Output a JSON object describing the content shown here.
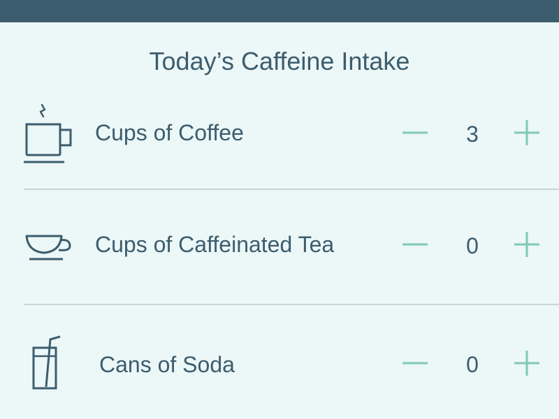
{
  "title": "Today’s Caffeine Intake",
  "colors": {
    "header": "#3c5d6e",
    "background": "#ecf7f7",
    "accent": "#7fcab0",
    "text": "#3c5d6e",
    "divider": "#c6d6d8"
  },
  "items": [
    {
      "icon": "coffee-mug-icon",
      "label": "Cups of Coffee",
      "count": "3"
    },
    {
      "icon": "teacup-icon",
      "label": "Cups of Caffeinated Tea",
      "count": "0"
    },
    {
      "icon": "soda-glass-icon",
      "label": "Cans of Soda",
      "count": "0"
    }
  ]
}
